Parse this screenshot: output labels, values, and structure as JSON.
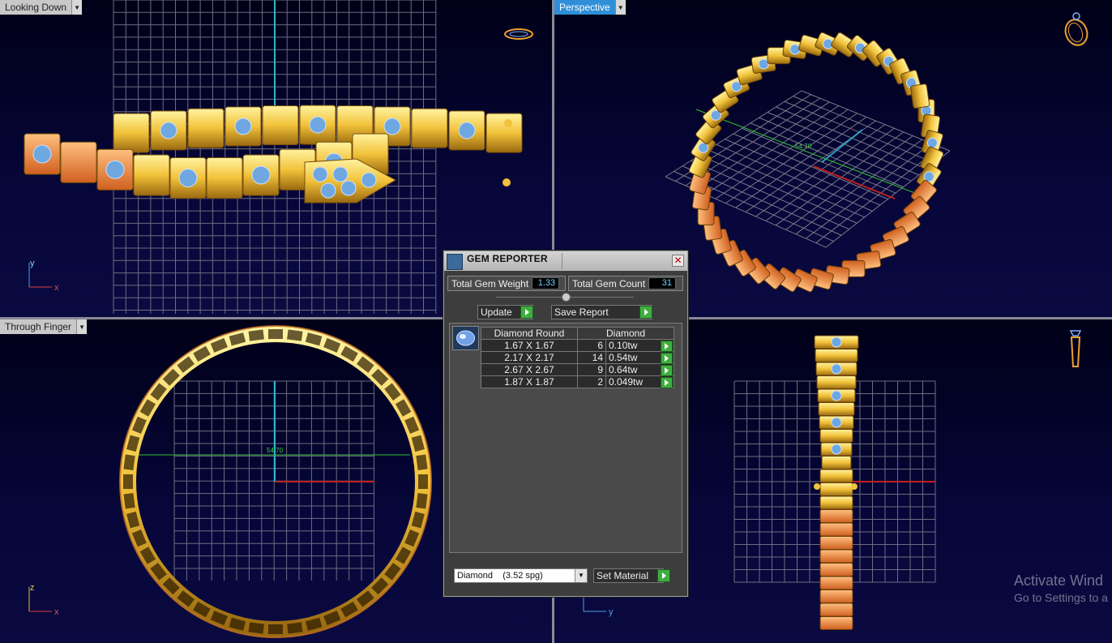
{
  "viewports": {
    "top_left": {
      "label": "Looking Down"
    },
    "top_right": {
      "label": "Perspective"
    },
    "bottom_left": {
      "label": "Through Finger"
    },
    "bottom_right": {
      "label": ""
    }
  },
  "dimension_labels": {
    "perspective": "54.70",
    "through_finger": "54.70"
  },
  "axes": {
    "top_left": {
      "v": "y",
      "h": "x"
    },
    "bottom_left": {
      "v": "z",
      "h": "x"
    },
    "bottom_right": {
      "h": "y"
    }
  },
  "gem_reporter": {
    "title": "GEM REPORTER",
    "total_weight_label": "Total Gem Weight",
    "total_weight_value": "1.33",
    "total_count_label": "Total Gem Count",
    "total_count_value": "31",
    "update_label": "Update",
    "save_report_label": "Save Report",
    "table": {
      "headers": [
        "Diamond Round",
        "Diamond"
      ],
      "rows": [
        {
          "size": "1.67 X 1.67",
          "count": "6",
          "weight": "0.10tw"
        },
        {
          "size": "2.17 X 2.17",
          "count": "14",
          "weight": "0.54tw"
        },
        {
          "size": "2.67 X 2.67",
          "count": "9",
          "weight": "0.64tw"
        },
        {
          "size": "1.87 X 1.87",
          "count": "2",
          "weight": "0.049tw"
        }
      ]
    },
    "material_selected": "Diamond    (3.52 spg)",
    "set_material_label": "Set Material"
  },
  "watermark": {
    "line1": "Activate Wind",
    "line2": "Go to Settings to a"
  },
  "colors": {
    "viewport_bg": "#06063a",
    "active_label": "#2f8fd8",
    "gold": "#f2c23a",
    "rose": "#e88a3a",
    "gem": "#6fa8e0",
    "grid": "#7a7a8a"
  }
}
